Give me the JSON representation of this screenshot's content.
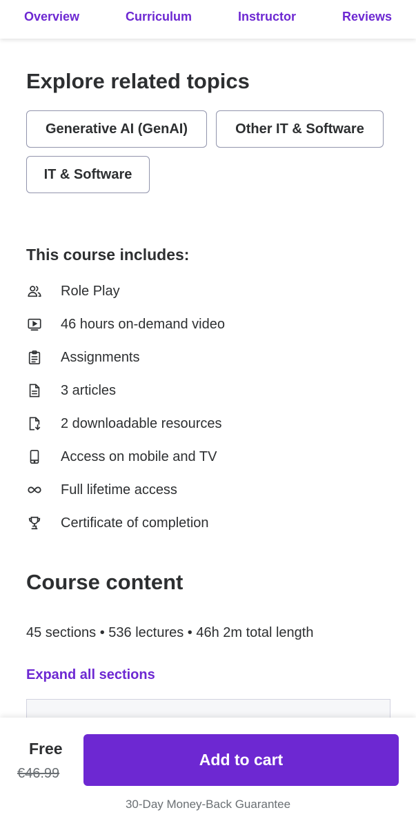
{
  "nav": {
    "tabs": [
      {
        "label": "Overview"
      },
      {
        "label": "Curriculum"
      },
      {
        "label": "Instructor"
      },
      {
        "label": "Reviews"
      }
    ]
  },
  "related": {
    "title": "Explore related topics",
    "topics": [
      "Generative AI (GenAI)",
      "Other IT & Software",
      "IT & Software"
    ]
  },
  "includes": {
    "title": "This course includes:",
    "items": [
      {
        "icon": "role-play-icon",
        "text": "Role Play"
      },
      {
        "icon": "video-icon",
        "text": "46 hours on-demand video"
      },
      {
        "icon": "assignment-icon",
        "text": "Assignments"
      },
      {
        "icon": "article-icon",
        "text": "3 articles"
      },
      {
        "icon": "download-file-icon",
        "text": "2 downloadable resources"
      },
      {
        "icon": "mobile-icon",
        "text": "Access on mobile and TV"
      },
      {
        "icon": "infinity-icon",
        "text": "Full lifetime access"
      },
      {
        "icon": "trophy-icon",
        "text": "Certificate of completion"
      }
    ]
  },
  "content": {
    "title": "Course content",
    "meta": "45 sections • 536 lectures • 46h 2m total length",
    "expand_label": "Expand all sections"
  },
  "purchase": {
    "price": "Free",
    "original_price": "€46.99",
    "cart_label": "Add to cart",
    "guarantee": "30-Day Money-Back Guarantee"
  },
  "colors": {
    "accent": "#6d28d2",
    "text": "#2d2f31",
    "muted": "#6a6f73"
  }
}
